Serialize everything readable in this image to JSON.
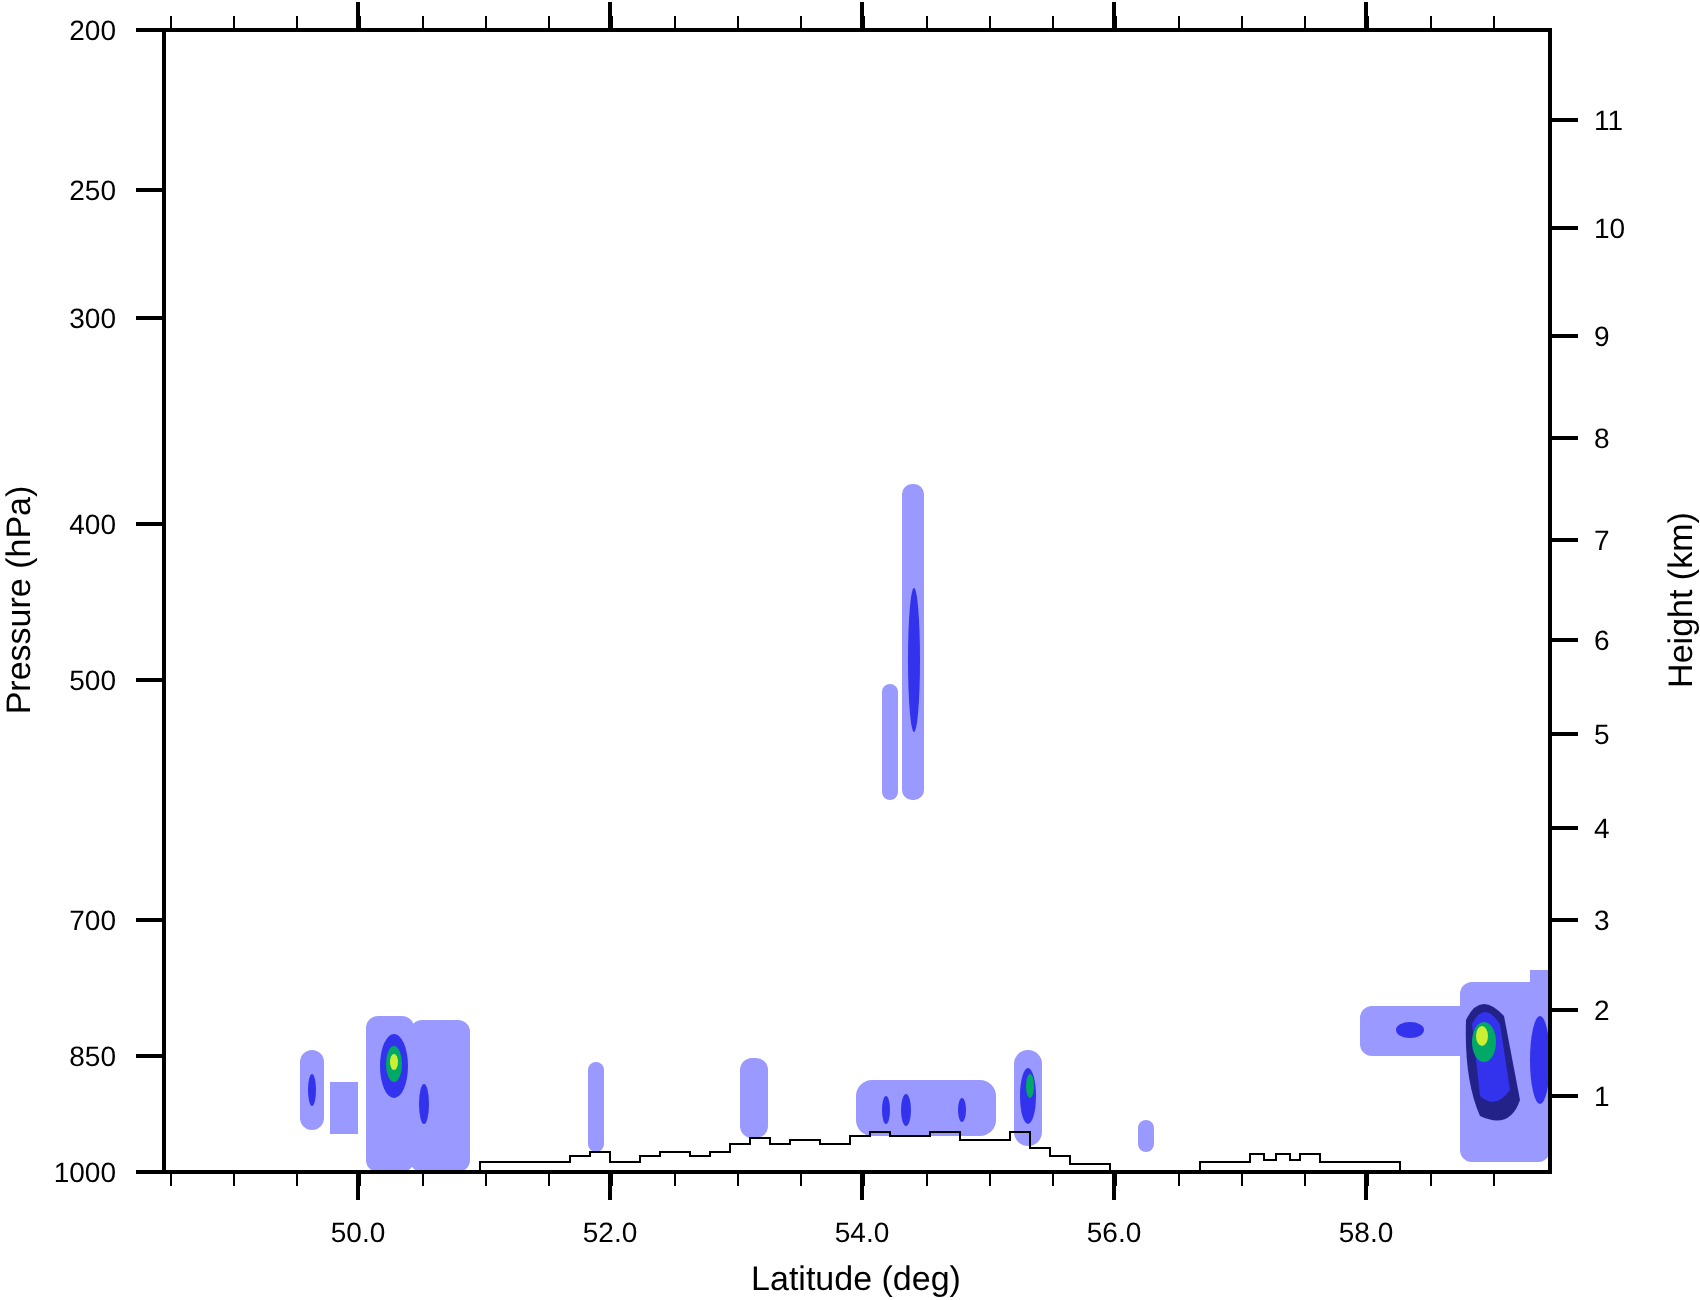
{
  "plot": {
    "xlabel": "Latitude (deg)",
    "ylabel_left": "Pressure (hPa)",
    "ylabel_right": "Height (km)",
    "x_ticks": [
      "50.0",
      "52.0",
      "54.0",
      "56.0",
      "58.0"
    ],
    "left_ticks": [
      "200",
      "250",
      "300",
      "400",
      "500",
      "700",
      "850",
      "1000"
    ],
    "right_ticks": [
      "11",
      "10",
      "9",
      "8",
      "7",
      "6",
      "5",
      "4",
      "3",
      "2",
      "1"
    ]
  }
}
